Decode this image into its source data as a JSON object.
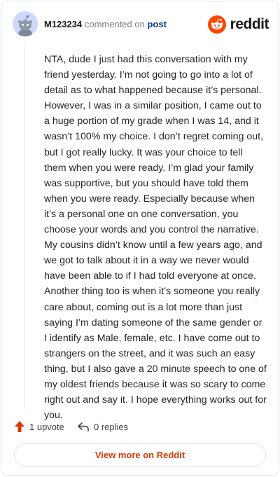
{
  "header": {
    "username": "M123234",
    "commented_on": "commented on",
    "post_link": "post",
    "brand_name": "reddit",
    "brand_color": "#ff4500"
  },
  "comment": {
    "text": "NTA, dude I just had this conversation with my friend yesterday. I’m not going to go into a lot of detail as to what happened because it’s personal. However, I was in a similar position, I came out to a huge portion of my grade when I was 14, and it wasn’t 100% my choice. I don’t regret coming out, but I got really lucky. It was your choice to tell them when you were ready. I’m glad your family was supportive, but you should have told them when you were ready. Especially because when it’s a personal one on one conversation, you choose your words and you control the narrative. My cousins didn’t know until a few years ago, and we got to talk about it in a way we never would have been able to if I had told everyone at once. Another thing too is when it’s someone you really care about, coming out is a lot more than just saying I’m dating someone of the same gender or I identify as Male, female, etc. I have come out to strangers on the street, and it was such an easy thing, but I also gave a 20 minute speech to one of my oldest friends because it was so scary to come right out and say it. I hope everything works out for you."
  },
  "footer": {
    "upvotes": "1 upvote",
    "replies": "0 replies",
    "upvote_color": "#d93a00"
  },
  "cta": {
    "label": "View more on Reddit",
    "color": "#d93a00"
  }
}
